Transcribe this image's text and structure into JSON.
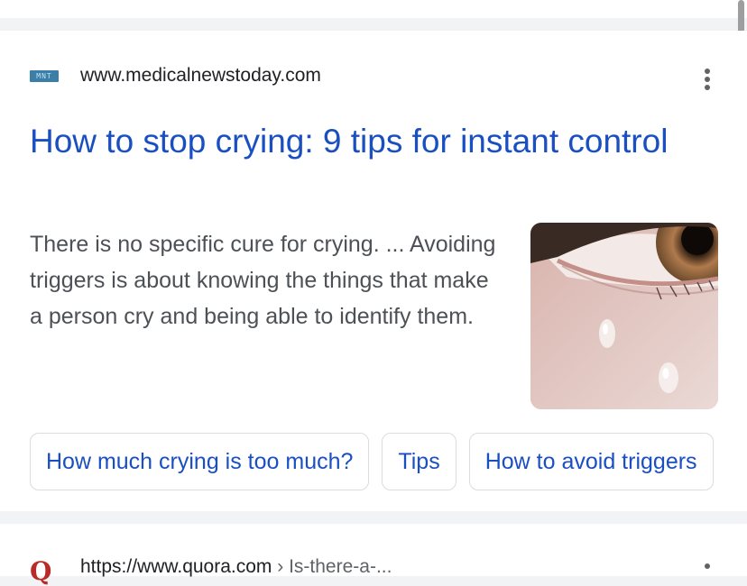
{
  "result1": {
    "favicon_text": "MNT",
    "site_url": "www.medicalnewstoday.com",
    "more_icon": "kebab-vertical-icon",
    "title": "How to stop crying: 9 tips for instant control",
    "snippet": "There is no specific cure for crying. ... Avoiding triggers is about knowing the things that make a person cry and being able to identify them.",
    "chips": [
      "How much crying is too much?",
      "Tips",
      "How to avoid triggers"
    ]
  },
  "result2": {
    "favicon_text": "Q",
    "site_url": "https://www.quora.com",
    "breadcrumb": "› Is-there-a-..."
  },
  "colors": {
    "link": "#1a4fc2",
    "text": "#202124",
    "snippet": "#4d5156",
    "quora": "#b92b27"
  }
}
